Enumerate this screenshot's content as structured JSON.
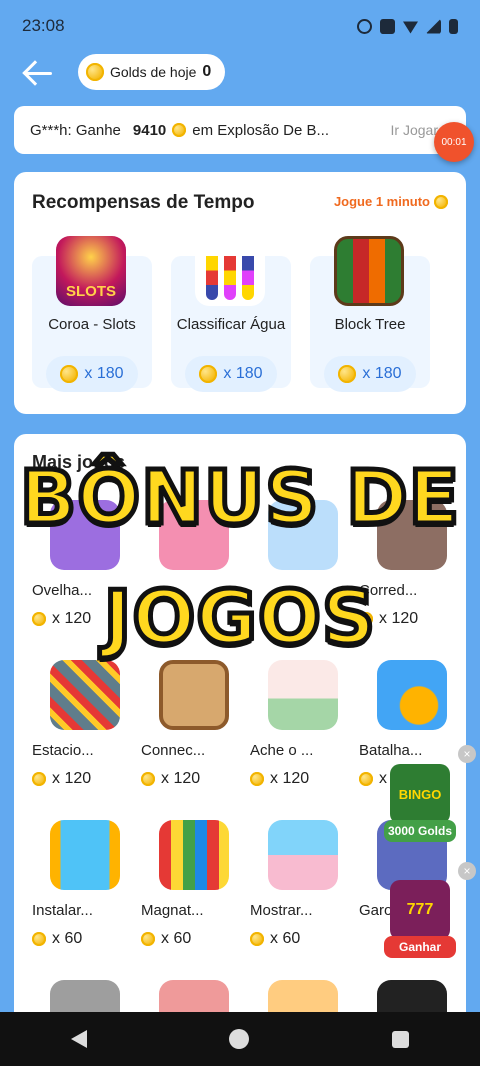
{
  "status": {
    "time": "23:08"
  },
  "header": {
    "golds_label": "Golds de hoje",
    "golds_value": "0"
  },
  "ticker": {
    "user": "G***h: Ganhe",
    "amount": "9410",
    "text": "em Explosão De B...",
    "action": "Ir Jogar",
    "timer": "00:01"
  },
  "time_rewards": {
    "title": "Recompensas de Tempo",
    "link": "Jogue 1 minuto",
    "items": [
      {
        "name": "Coroa - Slots",
        "reward": "x 180",
        "icon": "slots-art"
      },
      {
        "name": "Classificar Água",
        "reward": "x 180",
        "icon": "water-sort-art"
      },
      {
        "name": "Block Tree",
        "reward": "x 180",
        "icon": "block-tree-art"
      }
    ]
  },
  "more_games": {
    "title": "Mais jogos",
    "games": [
      {
        "name": "Ovelha...",
        "reward": "x 120"
      },
      {
        "name": "",
        "reward": ""
      },
      {
        "name": "",
        "reward": ""
      },
      {
        "name": "Corred...",
        "reward": "x 120"
      },
      {
        "name": "Estacio...",
        "reward": "x 120"
      },
      {
        "name": "Connec...",
        "reward": "x 120"
      },
      {
        "name": "Ache o ...",
        "reward": "x 120"
      },
      {
        "name": "Batalha...",
        "reward": "x"
      },
      {
        "name": "Instalar...",
        "reward": "x 60"
      },
      {
        "name": "Magnat...",
        "reward": "x 60"
      },
      {
        "name": "Mostrar...",
        "reward": "x 60"
      },
      {
        "name": "Garo",
        "reward": "x 60"
      }
    ]
  },
  "overlay": {
    "line1": "BÔNUS DE",
    "line2": "JOGOS"
  },
  "promos": [
    {
      "label": "3000 Golds",
      "art_text": "BINGO"
    },
    {
      "label": "Ganhar",
      "art_text": "777"
    }
  ],
  "colors": {
    "background": "#62a9f0",
    "accent": "#f06a1f",
    "reward_text": "#2a6fd6",
    "overlay_text": "#ffd81f"
  }
}
